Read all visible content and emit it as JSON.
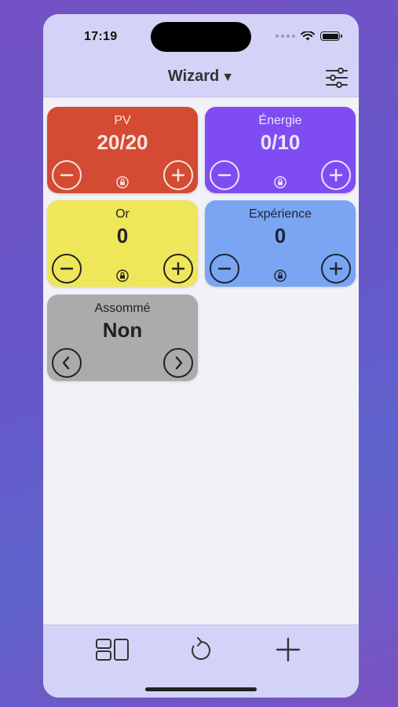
{
  "status_bar": {
    "time": "17:19"
  },
  "header": {
    "title": "Wizard",
    "caret": "▼",
    "settings_icon": "sliders-icon"
  },
  "counters": [
    {
      "label": "PV",
      "value": "20/20",
      "color": "#d44a33",
      "left_icon": "minus-circle-icon",
      "right_icon": "plus-circle-icon",
      "locked": true
    },
    {
      "label": "Énergie",
      "value": "0/10",
      "color": "#7f4cf3",
      "left_icon": "minus-circle-icon",
      "right_icon": "plus-circle-icon",
      "locked": true
    },
    {
      "label": "Or",
      "value": "0",
      "color": "#efe65a",
      "left_icon": "minus-circle-icon",
      "right_icon": "plus-circle-icon",
      "locked": true
    },
    {
      "label": "Expérience",
      "value": "0",
      "color": "#7aa5f2",
      "left_icon": "minus-circle-icon",
      "right_icon": "plus-circle-icon",
      "locked": true
    },
    {
      "label": "Assommé",
      "value": "Non",
      "color": "#ababab",
      "left_icon": "chevron-left-circle-icon",
      "right_icon": "chevron-right-circle-icon",
      "locked": false
    }
  ],
  "toolbar": {
    "layout_icon": "layout-icon",
    "reset_icon": "refresh-icon",
    "add_icon": "plus-icon"
  }
}
